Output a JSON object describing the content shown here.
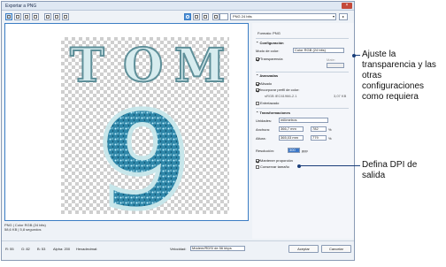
{
  "window": {
    "title": "Exportar a PNG",
    "close_label": "×"
  },
  "toolbar": {
    "preset": "PNG 24 bits",
    "preset_arrow": "▾",
    "next_arrow": "▸"
  },
  "status": {
    "line1": "PNG | Color RGB (24 bits)",
    "line2": "58,6 KB | 5,8 segundos"
  },
  "panel": {
    "format_label": "Formato:",
    "format_value": "PNG",
    "config_title": "Configuración",
    "color_mode_label": "Modo de color:",
    "color_mode_value": "Color RGB (24 bits)",
    "transparency_label": "Transparencia",
    "matte_label": "Mate:",
    "advanced_title": "Avanzadas",
    "smoothing_label": "Alisado",
    "embed_profile_label": "Incorporar perfil de color:",
    "profile_name": "sRGB IEC61966-2.1",
    "profile_size": "3,07 KB",
    "interlaced_label": "Entrelazado",
    "transform_title": "Transformaciones",
    "units_label": "Unidades:",
    "units_value": "milímetros",
    "width_label": "Anchura:",
    "width_mm": "366,7 mm",
    "width_px": "782",
    "height_label": "Altura:",
    "height_mm": "365,03 mm",
    "height_px": "779",
    "percent_sign": "%",
    "resolution_label": "Resolución:",
    "resolution_value": "300",
    "resolution_unit": "ppp",
    "keep_ratio_label": "Mantener proporción",
    "keep_size_label": "Conservar tamaño"
  },
  "bottombar": {
    "r": "R: 55",
    "g": "G: 82",
    "b": "B: 53",
    "alpha": "Alpha: 200",
    "hex": "Hexadecimal:",
    "speed_label": "Velocidad:",
    "speed_value": "Módem/RDSI de 56 kbps",
    "accept": "Aceptar",
    "cancel": "Cancelar"
  },
  "artwork": {
    "letters": [
      "T",
      "O",
      "M"
    ],
    "number": "9"
  },
  "callouts": {
    "top": [
      "Ajuste la",
      "transparencia y las",
      "otras",
      "configuraciones",
      "como requiera"
    ],
    "bottom": [
      "Defina DPI de",
      "salida"
    ]
  },
  "colors": {
    "accent": "#3b7dc4",
    "highlight": "#3c78c8",
    "callout_line": "#1a3e7a",
    "art_light": "#d7ecef",
    "art_sparkle": "#2e86a8"
  }
}
